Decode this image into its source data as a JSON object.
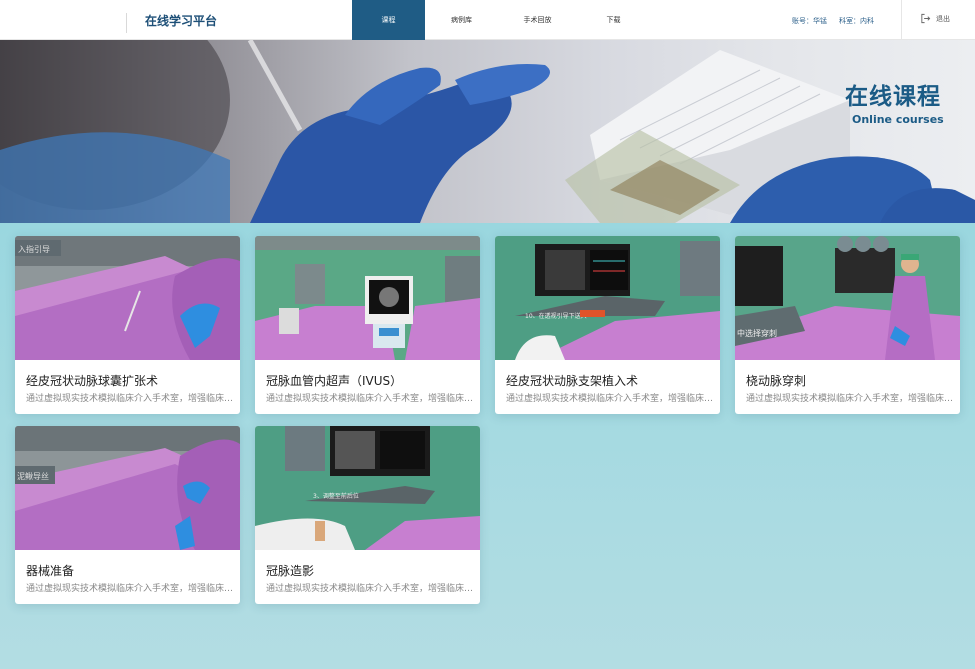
{
  "header": {
    "brand": "在线学习平台",
    "nav": [
      "课程",
      "病例库",
      "手术回放",
      "下载"
    ],
    "account": "账号：华锰",
    "department": "科室：内科",
    "logout_label": "退出"
  },
  "banner": {
    "title": "在线课程",
    "subtitle": "Online courses"
  },
  "courses": [
    {
      "title": "经皮冠状动脉球囊扩张术",
      "desc": "通过虚拟现实技术模拟临床介入手术室，增强临床技能培训的真实感"
    },
    {
      "title": "冠脉血管内超声（IVUS）",
      "desc": "通过虚拟现实技术模拟临床介入手术室，增强临床技能培训的真实感"
    },
    {
      "title": "经皮冠状动脉支架植入术",
      "desc": "通过虚拟现实技术模拟临床介入手术室，增强临床技能培训的真实感"
    },
    {
      "title": "桡动脉穿刺",
      "desc": "通过虚拟现实技术模拟临床介入手术室，增强临床技能培训的真实感"
    },
    {
      "title": "器械准备",
      "desc": "通过虚拟现实技术模拟临床介入手术室，增强临床技能培训的真实感"
    },
    {
      "title": "冠脉造影",
      "desc": "通过虚拟现实技术模拟临床介入手术室，增强临床技能培训的真实感"
    }
  ],
  "colors": {
    "primary": "#1f5c85",
    "brand_text": "#1d4f77",
    "background": "#9ed8e0",
    "drape": "#c67ad1"
  }
}
